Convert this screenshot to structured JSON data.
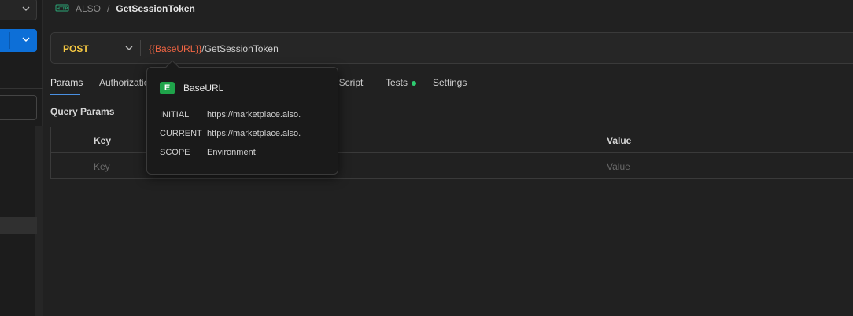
{
  "breadcrumb": {
    "icon": "http-icon",
    "parent": "ALSO",
    "separator": "/",
    "current": "GetSessionToken"
  },
  "request": {
    "method": "POST",
    "url_variable": "{{BaseURL}}",
    "url_path": "/GetSessionToken",
    "method_color": "#f5c842",
    "variable_color": "#f06543"
  },
  "tabs": [
    {
      "label": "Params",
      "active": true
    },
    {
      "label": "Authorization"
    },
    {
      "label": "t Script"
    },
    {
      "label": "Tests",
      "indicator": "#2ecc71"
    },
    {
      "label": "Settings"
    }
  ],
  "query_params": {
    "title": "Query Params",
    "columns": [
      "Key",
      "Value"
    ],
    "placeholders": {
      "key": "Key",
      "value": "Value"
    }
  },
  "variable_tooltip": {
    "badge": "E",
    "name": "BaseURL",
    "rows": [
      {
        "label": "INITIAL",
        "value": "https://marketplace.also."
      },
      {
        "label": "CURRENT",
        "value": "https://marketplace.also."
      },
      {
        "label": "SCOPE",
        "value": "Environment"
      }
    ]
  },
  "colors": {
    "accent_blue": "#0d6fd7",
    "tab_underline": "#4a90e2",
    "env_badge": "#1fa34a"
  }
}
